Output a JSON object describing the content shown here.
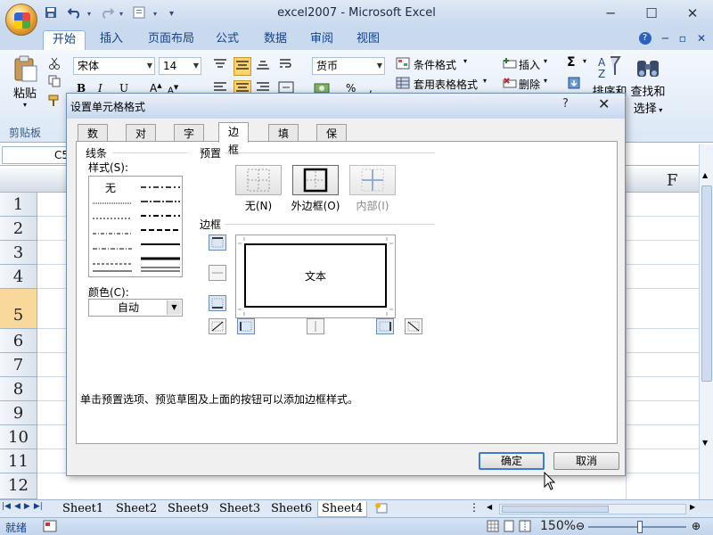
{
  "window": {
    "title": "excel2007 - Microsoft Excel",
    "minimize": "─",
    "restore": "☐",
    "close": "✕"
  },
  "ribbon_tabs": [
    "开始",
    "插入",
    "页面布局",
    "公式",
    "数据",
    "审阅",
    "视图"
  ],
  "ribbon": {
    "clipboard": {
      "paste_label": "粘贴",
      "group_label": "剪贴板"
    },
    "font": {
      "name": "宋体",
      "size": "14",
      "bold": "B",
      "italic": "I",
      "underline": "U"
    },
    "number": {
      "format": "货币",
      "percent": "%"
    },
    "styles": {
      "conditional_formatting": "条件格式",
      "format_as_table": "套用表格格式"
    },
    "cells": {
      "insert": "插入",
      "delete": "删除"
    },
    "editing": {
      "sum": "Σ",
      "sort_filter": "排序和",
      "find_select_line1": "查找和",
      "find_select_line2": "选择"
    }
  },
  "formula_bar": {
    "name_box": "C5"
  },
  "columns": [
    "F"
  ],
  "rows": [
    "1",
    "2",
    "3",
    "4",
    "5",
    "6",
    "7",
    "8",
    "9",
    "10",
    "11",
    "12"
  ],
  "sheet_tabs": [
    "Sheet1",
    "Sheet2",
    "Sheet9",
    "Sheet3",
    "Sheet6",
    "Sheet4"
  ],
  "active_sheet": "Sheet4",
  "status": {
    "ready": "就绪",
    "zoom": "150%"
  },
  "dialog": {
    "title": "设置单元格格式",
    "help": "?",
    "close": "✕",
    "tabs": [
      "数字",
      "对齐",
      "字体",
      "边框",
      "填充",
      "保护"
    ],
    "active_tab": "边框",
    "line_group": "线条",
    "style_label": "样式(S):",
    "style_none": "无",
    "color_label": "颜色(C):",
    "color_value": "自动",
    "preset_group": "预置",
    "presets": [
      {
        "label": "无(N)",
        "enabled": true
      },
      {
        "label": "外边框(O)",
        "enabled": true
      },
      {
        "label": "内部(I)",
        "enabled": false
      }
    ],
    "border_group": "边框",
    "preview_text": "文本",
    "hint": "单击预置选项、预览草图及上面的按钮可以添加边框样式。",
    "ok": "确定",
    "cancel": "取消"
  }
}
